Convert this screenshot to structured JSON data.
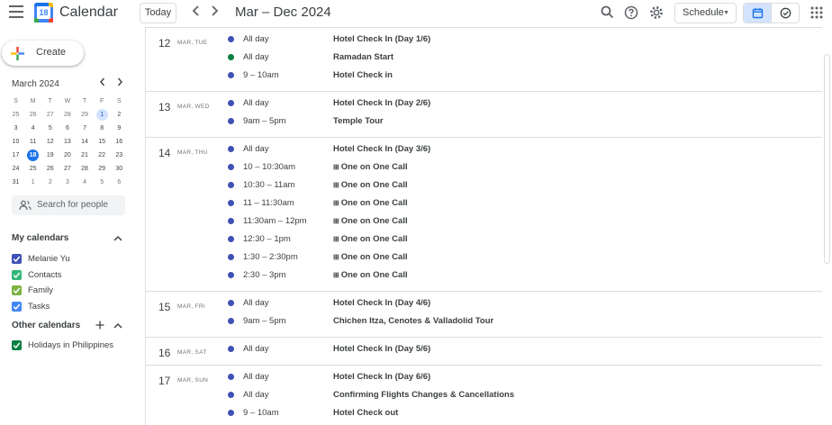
{
  "header": {
    "app_title": "Calendar",
    "logo_day": "18",
    "today_label": "Today",
    "date_range": "Mar – Dec 2024",
    "view_label": "Schedule",
    "icons": [
      "menu-icon",
      "search-icon",
      "help-icon",
      "settings-icon",
      "calendar-view-icon",
      "tasks-icon",
      "apps-icon"
    ]
  },
  "sidebar": {
    "create_label": "Create",
    "month_label": "March 2024",
    "weekday_headers": [
      "S",
      "M",
      "T",
      "W",
      "T",
      "F",
      "S"
    ],
    "weeks": [
      [
        "25",
        "26",
        "27",
        "28",
        "29",
        "1",
        "2"
      ],
      [
        "3",
        "4",
        "5",
        "6",
        "7",
        "8",
        "9"
      ],
      [
        "10",
        "11",
        "12",
        "13",
        "14",
        "15",
        "16"
      ],
      [
        "17",
        "18",
        "19",
        "20",
        "21",
        "22",
        "23"
      ],
      [
        "24",
        "25",
        "26",
        "27",
        "28",
        "29",
        "30"
      ],
      [
        "31",
        "1",
        "2",
        "3",
        "4",
        "5",
        "6"
      ]
    ],
    "search_placeholder": "Search for people",
    "my_calendars_title": "My calendars",
    "my_calendars": [
      {
        "name": "Melanie Yu",
        "color": "#3f51b5"
      },
      {
        "name": "Contacts",
        "color": "#33b679"
      },
      {
        "name": "Family",
        "color": "#7cb342"
      },
      {
        "name": "Tasks",
        "color": "#4285f4"
      }
    ],
    "other_calendars_title": "Other calendars",
    "other_calendars": [
      {
        "name": "Holidays in Philippines",
        "color": "#0b8043"
      }
    ]
  },
  "colors": {
    "event_blue": "#3f51b5",
    "event_green": "#0b8043",
    "accent": "#1a73e8"
  },
  "schedule": [
    {
      "num": "12",
      "meta": "MAR, TUE",
      "events": [
        {
          "time": "All day",
          "title": "Hotel Check In (Day 1/6)",
          "color": "#3f51b5"
        },
        {
          "time": "All day",
          "title": "Ramadan Start",
          "color": "#0b8043"
        },
        {
          "time": "9 – 10am",
          "title": "Hotel Check in",
          "color": "#3f51b5"
        }
      ]
    },
    {
      "num": "13",
      "meta": "MAR, WED",
      "events": [
        {
          "time": "All day",
          "title": "Hotel Check In (Day 2/6)",
          "color": "#3f51b5"
        },
        {
          "time": "9am – 5pm",
          "title": "Temple Tour",
          "color": "#3f51b5"
        }
      ]
    },
    {
      "num": "14",
      "meta": "MAR, THU",
      "events": [
        {
          "time": "All day",
          "title": "Hotel Check In (Day 3/6)",
          "color": "#3f51b5"
        },
        {
          "time": "10 – 10:30am",
          "title": "One on One Call",
          "color": "#3f51b5",
          "grid": true
        },
        {
          "time": "10:30 – 11am",
          "title": "One on One Call",
          "color": "#3f51b5",
          "grid": true
        },
        {
          "time": "11 – 11:30am",
          "title": "One on One Call",
          "color": "#3f51b5",
          "grid": true
        },
        {
          "time": "11:30am – 12pm",
          "title": "One on One Call",
          "color": "#3f51b5",
          "grid": true
        },
        {
          "time": "12:30 – 1pm",
          "title": "One on One Call",
          "color": "#3f51b5",
          "grid": true
        },
        {
          "time": "1:30 – 2:30pm",
          "title": "One on One Call",
          "color": "#3f51b5",
          "grid": true
        },
        {
          "time": "2:30 – 3pm",
          "title": "One on One Call",
          "color": "#3f51b5",
          "grid": true
        }
      ]
    },
    {
      "num": "15",
      "meta": "MAR, FRI",
      "events": [
        {
          "time": "All day",
          "title": "Hotel Check In (Day 4/6)",
          "color": "#3f51b5"
        },
        {
          "time": "9am – 5pm",
          "title": "Chichen Itza, Cenotes & Valladolid Tour",
          "color": "#3f51b5"
        }
      ]
    },
    {
      "num": "16",
      "meta": "MAR, SAT",
      "events": [
        {
          "time": "All day",
          "title": "Hotel Check In (Day 5/6)",
          "color": "#3f51b5"
        }
      ]
    },
    {
      "num": "17",
      "meta": "MAR, SUN",
      "events": [
        {
          "time": "All day",
          "title": "Hotel Check In (Day 6/6)",
          "color": "#3f51b5"
        },
        {
          "time": "All day",
          "title": "Confirming Flights Changes & Cancellations",
          "color": "#3f51b5"
        },
        {
          "time": "9 – 10am",
          "title": "Hotel Check out",
          "color": "#3f51b5"
        }
      ]
    }
  ]
}
